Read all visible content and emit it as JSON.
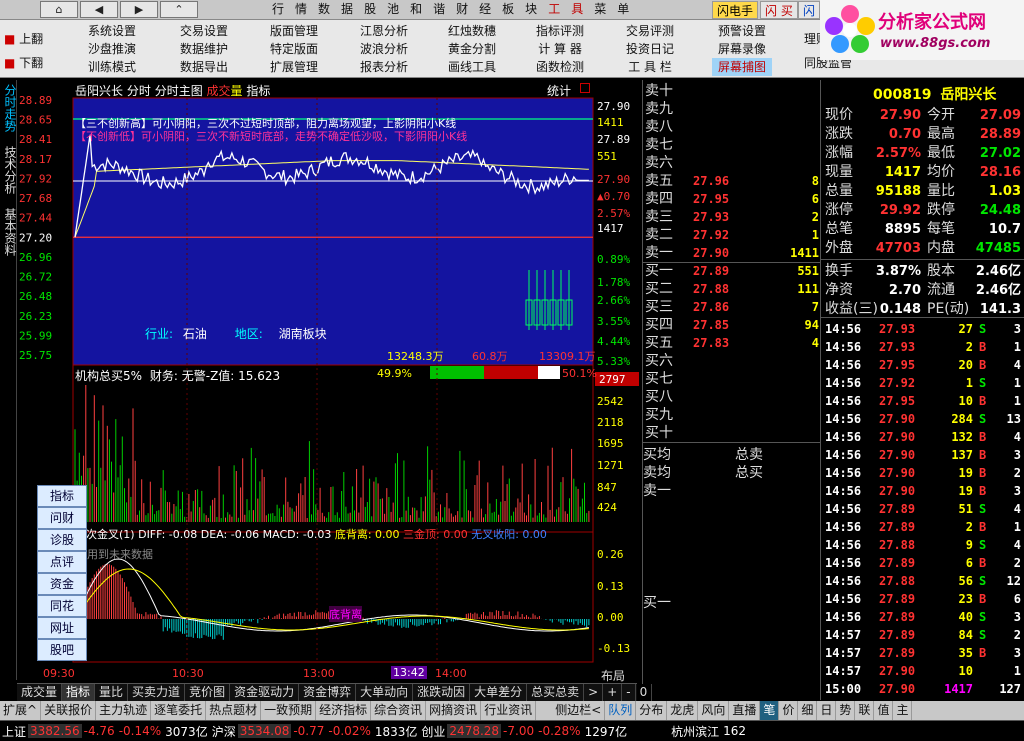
{
  "topbar": {
    "nav": [
      "⌂",
      "◀",
      "▶",
      "⌃"
    ],
    "menu": [
      "行",
      "情",
      "数",
      "据",
      "股",
      "池",
      "和",
      "谐",
      "财",
      "经",
      "板",
      "块",
      "工",
      "具",
      "菜",
      "单"
    ],
    "flash": [
      "闪电手",
      "闪 买",
      "闪 卖"
    ]
  },
  "toolbar": {
    "up": "上翻",
    "down": "下翻",
    "cols": [
      [
        "系统设置",
        "沙盘推演",
        "训练模式"
      ],
      [
        "交易设置",
        "数据维护",
        "数据导出"
      ],
      [
        "版面管理",
        "特定版面",
        "扩展管理"
      ],
      [
        "江恩分析",
        "波浪分析",
        "报表分析"
      ],
      [
        "红烛数穗",
        "黄金分割",
        "画线工具"
      ],
      [
        "指标评测",
        "计 算 器",
        "函数检测"
      ],
      [
        "交易评测",
        "投资日记",
        "工 具 栏"
      ],
      [
        "预警设置",
        "屏幕录像",
        "屏幕捕图"
      ]
    ],
    "extra": [
      "理财",
      "同股监管"
    ]
  },
  "logo": {
    "title": "分析家公式网",
    "url": "www.88gs.com"
  },
  "lefttabs": [
    "分时走势",
    "技术分析",
    "基本资料"
  ],
  "chart": {
    "header": [
      "岳阳兴长",
      "分时",
      "分时主图"
    ],
    "header_red": "成交",
    "header2": "量",
    "header3": "指标",
    "stat": "统计",
    "info1": "【三不创新高】可小阴阳，三次不过短时顶部，阻力离场观望，上影阴阳小K线",
    "info2": "【不创新低】可小阴阳，三次不新短时底部，走势不确定低沙吸，下影阴阳小K线",
    "industry_label": "行业:",
    "industry": "石油",
    "region_label": "地区:",
    "region": "湖南板块",
    "left_prices": [
      "28.89",
      "28.65",
      "28.41",
      "28.17",
      "27.92",
      "27.68",
      "27.44",
      "27.20",
      "26.96",
      "26.72",
      "26.48",
      "26.23",
      "25.99",
      "25.75"
    ],
    "right_top": [
      "27.90",
      "1411",
      "27.89",
      "551",
      "27.90",
      "▲0.70",
      "2.57%",
      "1417"
    ],
    "right_pct": [
      "0.89%",
      "1.78%",
      "2.66%",
      "3.55%",
      "4.44%",
      "5.33%"
    ],
    "bar_left": "13248.3万",
    "bar_mid": "60.8万",
    "bar_right": "13309.1万",
    "bar_pct_l": "49.9%",
    "bar_pct_r": "50.1%",
    "inst": "机构总买5%",
    "finance": "财务: 无警-Z值: 15.623",
    "vol_cur": "2797",
    "vol_axis": [
      "2542",
      "2118",
      "1695",
      "1271",
      "847",
      "424"
    ],
    "macd_title": "二次金叉(1)",
    "macd_vals": "DIFF: -0.08  DEA: -0.06  MACD: -0.03",
    "macd_bottom": "底背离: 0.00",
    "macd_sanlv": "三金顶: 0.00",
    "macd_jy": "无叉收阳: 0.00",
    "macd_note": "用到未来数据",
    "macd_mark": "底背离",
    "macd_axis": [
      "0.26",
      "0.13",
      "0.00",
      "-0.13"
    ],
    "time_axis": [
      "09:30",
      "10:30",
      "13:00",
      "13:42",
      "14:00"
    ],
    "layout": "布局",
    "side_buttons": [
      "指标",
      "问财",
      "诊股",
      "点评",
      "资金",
      "同花",
      "网址",
      "股吧"
    ],
    "close_price": 27.2
  },
  "orderbook": {
    "sell_labels": [
      "卖十",
      "卖九",
      "卖八",
      "卖七",
      "卖六",
      "卖五",
      "卖四",
      "卖三",
      "卖二",
      "卖一"
    ],
    "sell": [
      [
        "",
        ""
      ],
      [
        "",
        ""
      ],
      [
        "",
        ""
      ],
      [
        "",
        ""
      ],
      [
        "",
        ""
      ],
      [
        "27.96",
        "8"
      ],
      [
        "27.95",
        "6"
      ],
      [
        "27.93",
        "2"
      ],
      [
        "27.92",
        "1"
      ],
      [
        "27.90",
        "1411"
      ]
    ],
    "buy_labels": [
      "买一",
      "买二",
      "买三",
      "买四",
      "买五",
      "买六",
      "买七",
      "买八",
      "买九",
      "买十"
    ],
    "buy": [
      [
        "27.89",
        "551"
      ],
      [
        "27.88",
        "111"
      ],
      [
        "27.86",
        "7"
      ],
      [
        "27.85",
        "94"
      ],
      [
        "27.83",
        "4"
      ],
      [
        "",
        ""
      ],
      [
        "",
        ""
      ],
      [
        "",
        ""
      ],
      [
        "",
        ""
      ],
      [
        "",
        ""
      ]
    ],
    "avg_buy": "买均",
    "avg_sell": "卖均",
    "total_sell": "总卖",
    "total_buy": "总买",
    "sell1": "卖一",
    "buy1": "买一"
  },
  "quote": {
    "code": "000819",
    "name": "岳阳兴长",
    "rows": [
      [
        "现价",
        "27.90",
        "今开",
        "27.09"
      ],
      [
        "涨跌",
        "0.70",
        "最高",
        "28.89"
      ],
      [
        "涨幅",
        "2.57%",
        "最低",
        "27.02"
      ],
      [
        "现量",
        "1417",
        "均价",
        "28.16"
      ],
      [
        "总量",
        "95188",
        "量比",
        "1.03"
      ],
      [
        "涨停",
        "29.92",
        "跌停",
        "24.48"
      ],
      [
        "总笔",
        "8895",
        "每笔",
        "10.7"
      ],
      [
        "外盘",
        "47703",
        "内盘",
        "47485"
      ],
      [
        "换手",
        "3.87%",
        "股本",
        "2.46亿"
      ],
      [
        "净资",
        "2.70",
        "流通",
        "2.46亿"
      ],
      [
        "收益(三)",
        "0.148",
        "PE(动)",
        "141.3"
      ]
    ]
  },
  "ticks": [
    [
      "14:56",
      "27.93",
      "27",
      "S",
      "3"
    ],
    [
      "14:56",
      "27.93",
      "2",
      "B",
      "1"
    ],
    [
      "14:56",
      "27.95",
      "20",
      "B",
      "4"
    ],
    [
      "14:56",
      "27.92",
      "1",
      "S",
      "1"
    ],
    [
      "14:56",
      "27.95",
      "10",
      "B",
      "1"
    ],
    [
      "14:56",
      "27.90",
      "284",
      "S",
      "13"
    ],
    [
      "14:56",
      "27.90",
      "132",
      "B",
      "4"
    ],
    [
      "14:56",
      "27.90",
      "137",
      "B",
      "3"
    ],
    [
      "14:56",
      "27.90",
      "19",
      "B",
      "2"
    ],
    [
      "14:56",
      "27.90",
      "19",
      "B",
      "3"
    ],
    [
      "14:56",
      "27.89",
      "51",
      "S",
      "4"
    ],
    [
      "14:56",
      "27.89",
      "2",
      "B",
      "1"
    ],
    [
      "14:56",
      "27.88",
      "9",
      "S",
      "4"
    ],
    [
      "14:56",
      "27.89",
      "6",
      "B",
      "2"
    ],
    [
      "14:56",
      "27.88",
      "56",
      "S",
      "12"
    ],
    [
      "14:56",
      "27.89",
      "23",
      "B",
      "6"
    ],
    [
      "14:56",
      "27.89",
      "40",
      "S",
      "3"
    ],
    [
      "14:57",
      "27.89",
      "84",
      "S",
      "2"
    ],
    [
      "14:57",
      "27.89",
      "35",
      "B",
      "3"
    ],
    [
      "14:57",
      "27.90",
      "10",
      "",
      "1"
    ],
    [
      "15:00",
      "27.90",
      "1417",
      "",
      "127"
    ]
  ],
  "bottomtabs": [
    "成交量",
    "指标",
    "量比",
    "买卖力道",
    "竞价图",
    "资金驱动力",
    "资金博弈",
    "大单动向",
    "涨跌动因",
    "大单差分",
    "总买总卖",
    ">",
    "+",
    "-",
    "0"
  ],
  "bottomtabs2": [
    "扩展^",
    "关联报价",
    "主力轨迹",
    "逐笔委托",
    "热点题材",
    "一致预期",
    "经济指标",
    "综合资讯",
    "网摘资讯",
    "行业资讯",
    "侧边栏<",
    "队列",
    "分布",
    "龙虎",
    "风向",
    "直播",
    "笔",
    "价",
    "细",
    "日",
    "势",
    "联",
    "值",
    "主"
  ],
  "status": [
    "上证",
    "3382.56",
    "-4.76",
    "-0.14%",
    "3073亿",
    "沪深",
    "3534.08",
    "-0.77",
    "-0.02%",
    "1833亿",
    "创业",
    "2478.28",
    "-7.00",
    "-0.28%",
    "1297亿",
    "杭州滨江",
    "162"
  ]
}
